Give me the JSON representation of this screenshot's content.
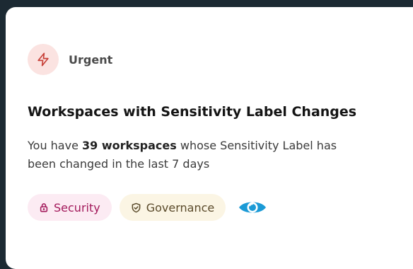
{
  "badge": {
    "label": "Urgent",
    "icon": "lightning-icon",
    "icon_bg": "#fbe3e1",
    "icon_color": "#c8423a"
  },
  "card": {
    "title": "Workspaces with Sensitivity Label Changes",
    "description": {
      "prefix": "You have ",
      "emphasis": "39 workspaces",
      "suffix": " whose Sensitivity Label has been changed in the last 7 days"
    }
  },
  "tags": [
    {
      "label": "Security",
      "icon": "lock-icon",
      "bg": "#fcebf3",
      "color": "#a3195b"
    },
    {
      "label": "Governance",
      "icon": "shield-check-icon",
      "bg": "#fbf5e4",
      "color": "#5a4a2a"
    }
  ],
  "view_icon": {
    "icon": "eye-icon",
    "color": "#1b9ad6"
  }
}
